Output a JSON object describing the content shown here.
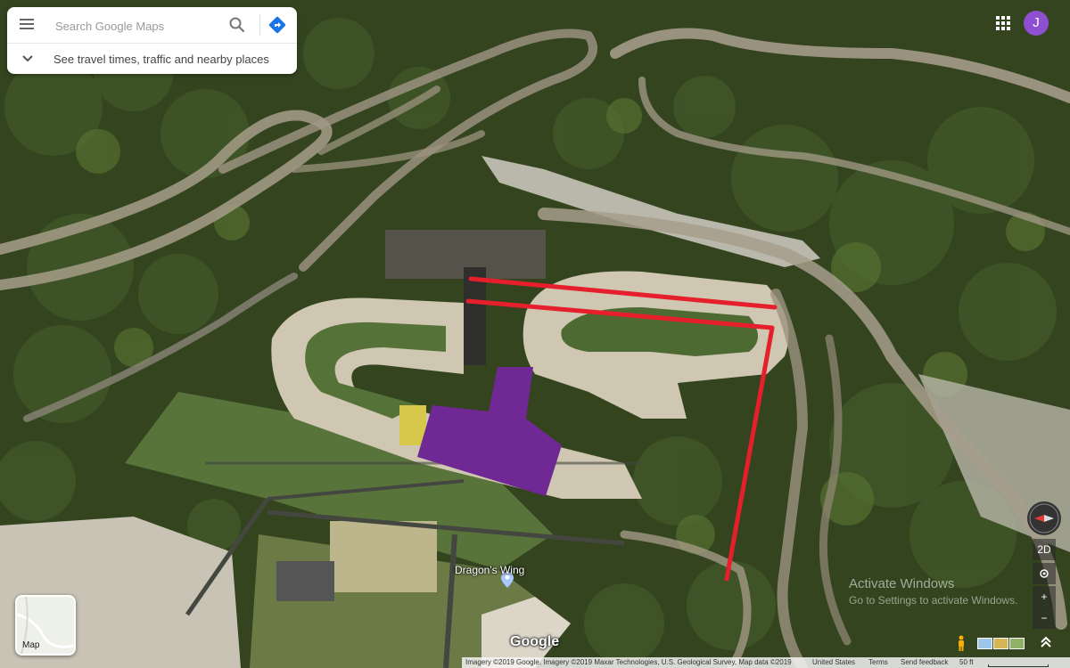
{
  "search": {
    "placeholder": "Search Google Maps",
    "travel_prompt": "See travel times, traffic and nearby places"
  },
  "account": {
    "avatar_letter": "J"
  },
  "map": {
    "place_label": "Dragon's Wing",
    "layer_toggle_label": "Map",
    "view_mode": "2D",
    "logo": "Google",
    "activate_windows_title": "Activate Windows",
    "activate_windows_sub": "Go to Settings to activate Windows."
  },
  "attribution": {
    "imagery": "Imagery ©2019 Google, Imagery ©2019 Maxar Technologies, U.S. Geological Survey, Map data ©2019",
    "region": "United States",
    "terms": "Terms",
    "feedback": "Send feedback",
    "scale": "50 ft"
  },
  "controls": {
    "zoom_in": "+",
    "zoom_out": "−"
  },
  "colors": {
    "overlay_line": "#e51f2b",
    "overlay_shape": "#6f2894",
    "avatar": "#8e4fd1",
    "directions": "#1a73e8"
  },
  "icons": [
    "menu-icon",
    "search-icon",
    "directions-icon",
    "chevron-down-icon",
    "apps-grid-icon",
    "compass-icon",
    "location-icon",
    "pegman-icon",
    "expand-icon"
  ]
}
